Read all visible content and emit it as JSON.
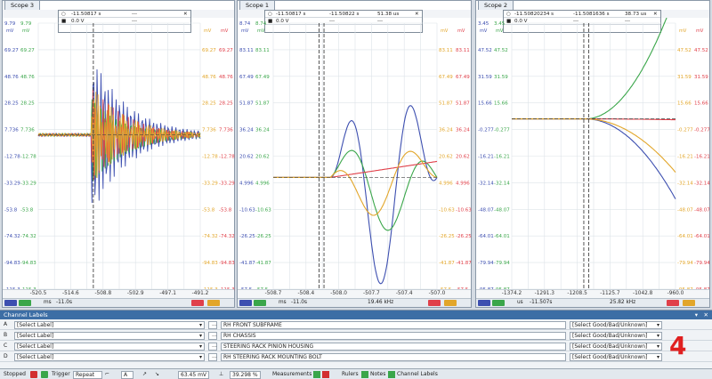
{
  "scopes": [
    {
      "title": "Scope 3",
      "left_tick_pairs": [
        [
          "9.79",
          "9.79"
        ],
        [
          "69.27",
          "69.27"
        ],
        [
          "48.76",
          "48.76"
        ],
        [
          "28.25",
          "28.25"
        ],
        [
          "7.736",
          "7.736"
        ],
        [
          "-12.78",
          "-12.78"
        ],
        [
          "-33.29",
          "-33.29"
        ],
        [
          "-53.8",
          "-53.8"
        ],
        [
          "-74.32",
          "-74.32"
        ],
        [
          "-94.83",
          "-94.83"
        ],
        [
          "-115.3",
          "-115.3"
        ]
      ],
      "right_tick_pairs": [
        [
          "69.27",
          "69.27"
        ],
        [
          "48.76",
          "48.76"
        ],
        [
          "28.25",
          "28.25"
        ],
        [
          "7.736",
          "7.736"
        ],
        [
          "-12.78",
          "-12.78"
        ],
        [
          "-33.29",
          "-33.29"
        ],
        [
          "-53.8",
          "-53.8"
        ],
        [
          "-74.32",
          "-74.32"
        ],
        [
          "-94.83",
          "-94.83"
        ],
        [
          "-115.3",
          "-115.3"
        ]
      ],
      "unit": "mV",
      "x_ticks": [
        "-520.5",
        "-514.6",
        "-508.8",
        "-502.9",
        "-497.1",
        "-491.2"
      ],
      "x_unit": "ms",
      "status_time": "-11.0s",
      "ruler": {
        "t1": "-11.50817 s",
        "v": "0.0 V",
        "a": "---",
        "b": "---"
      }
    },
    {
      "title": "Scope 1",
      "left_tick_pairs": [
        [
          "8.74",
          "8.74"
        ],
        [
          "83.11",
          "83.11"
        ],
        [
          "67.49",
          "67.49"
        ],
        [
          "51.87",
          "51.87"
        ],
        [
          "36.24",
          "36.24"
        ],
        [
          "20.62",
          "20.62"
        ],
        [
          "4.996",
          "4.996"
        ],
        [
          "-10.63",
          "-10.63"
        ],
        [
          "-26.25",
          "-26.25"
        ],
        [
          "-41.87",
          "-41.87"
        ],
        [
          "-57.5",
          "-57.5"
        ]
      ],
      "right_tick_pairs": [
        [
          "83.11",
          "83.11"
        ],
        [
          "67.49",
          "67.49"
        ],
        [
          "51.87",
          "51.87"
        ],
        [
          "36.24",
          "36.24"
        ],
        [
          "20.62",
          "20.62"
        ],
        [
          "4.996",
          "4.996"
        ],
        [
          "-10.63",
          "-10.63"
        ],
        [
          "-26.25",
          "-26.25"
        ],
        [
          "-41.87",
          "-41.87"
        ],
        [
          "-57.5",
          "-57.5"
        ]
      ],
      "unit": "mV",
      "x_ticks": [
        "-508.7",
        "-508.4",
        "-508.0",
        "-507.7",
        "-507.4",
        "-507.0"
      ],
      "x_unit": "ms",
      "status_time": "-11.0s",
      "status_freq": "19.46 kHz",
      "ruler": {
        "t1": "-11.50817 s",
        "t2": "-11.50822 s",
        "dt": "51.38 us",
        "v": "0.0 V",
        "a": "---",
        "b": "---"
      }
    },
    {
      "title": "Scope 2",
      "left_tick_pairs": [
        [
          "3.45",
          "3.45"
        ],
        [
          "47.52",
          "47.52"
        ],
        [
          "31.59",
          "31.59"
        ],
        [
          "15.66",
          "15.66"
        ],
        [
          "-0.277",
          "-0.277"
        ],
        [
          "-16.21",
          "-16.21"
        ],
        [
          "-32.14",
          "-32.14"
        ],
        [
          "-48.07",
          "-48.07"
        ],
        [
          "-64.01",
          "-64.01"
        ],
        [
          "-79.94",
          "-79.94"
        ],
        [
          "-95.87",
          "-95.87"
        ]
      ],
      "right_tick_pairs": [
        [
          "47.52",
          "47.52"
        ],
        [
          "31.59",
          "31.59"
        ],
        [
          "15.66",
          "15.66"
        ],
        [
          "-0.277",
          "-0.277"
        ],
        [
          "-16.21",
          "-16.21"
        ],
        [
          "-32.14",
          "-32.14"
        ],
        [
          "-48.07",
          "-48.07"
        ],
        [
          "-64.01",
          "-64.01"
        ],
        [
          "-79.94",
          "-79.94"
        ],
        [
          "-95.87",
          "-95.87"
        ]
      ],
      "unit": "mV",
      "x_ticks": [
        "-1374.2",
        "-1291.3",
        "-1208.5",
        "-1125.7",
        "-1042.8",
        "-960.0"
      ],
      "x_unit": "us",
      "status_time": "-11.507s",
      "status_freq": "25.82 kHz",
      "ruler": {
        "t1": "-11.50820234 s",
        "t2": "-11.5081636 s",
        "dt": "38.73 us",
        "v": "0.0 V",
        "a": "---",
        "b": "---"
      }
    }
  ],
  "channel_panel": {
    "title": "Channel Labels",
    "rows": [
      {
        "ch": "A",
        "select": "[Select Label]",
        "label": "RH FRONT SUBFRAME",
        "grade": "[Select Good/Bad/Unknown]"
      },
      {
        "ch": "B",
        "select": "[Select Label]",
        "label": "RH CHASSIS",
        "grade": "[Select Good/Bad/Unknown]"
      },
      {
        "ch": "C",
        "select": "[Select Label]",
        "label": "STEERING RACK PINION HOUSING",
        "grade": "[Select Good/Bad/Unknown]"
      },
      {
        "ch": "D",
        "select": "[Select Label]",
        "label": "RH STEERING RACK MOUNTING BOLT",
        "grade": "[Select Good/Bad/Unknown]"
      }
    ],
    "big_number": "4"
  },
  "toolbar": {
    "state": "Stopped",
    "trigger": "Trigger",
    "mode": "Repeat",
    "channel": "A",
    "level": "63.45 mV",
    "zoom": "39.298 %",
    "measurements": "Measurements",
    "rulers": "Rulers",
    "notes": "Notes",
    "channel_labels": "Channel Labels"
  },
  "colors": {
    "blue": "#3d4fb0",
    "green": "#3aa64a",
    "red": "#e0404a",
    "orange": "#e2a62a",
    "accent": "#3d6ea5",
    "number_red": "#e02020"
  }
}
